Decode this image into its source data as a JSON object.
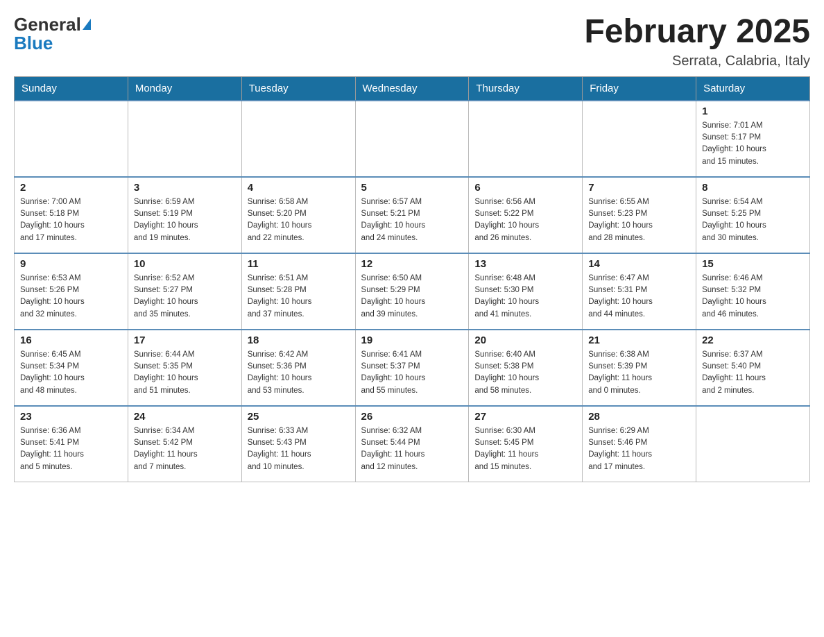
{
  "header": {
    "logo_general": "General",
    "logo_blue": "Blue",
    "month_title": "February 2025",
    "subtitle": "Serrata, Calabria, Italy"
  },
  "days_of_week": [
    "Sunday",
    "Monday",
    "Tuesday",
    "Wednesday",
    "Thursday",
    "Friday",
    "Saturday"
  ],
  "weeks": [
    {
      "days": [
        {
          "num": "",
          "info": ""
        },
        {
          "num": "",
          "info": ""
        },
        {
          "num": "",
          "info": ""
        },
        {
          "num": "",
          "info": ""
        },
        {
          "num": "",
          "info": ""
        },
        {
          "num": "",
          "info": ""
        },
        {
          "num": "1",
          "info": "Sunrise: 7:01 AM\nSunset: 5:17 PM\nDaylight: 10 hours\nand 15 minutes."
        }
      ]
    },
    {
      "days": [
        {
          "num": "2",
          "info": "Sunrise: 7:00 AM\nSunset: 5:18 PM\nDaylight: 10 hours\nand 17 minutes."
        },
        {
          "num": "3",
          "info": "Sunrise: 6:59 AM\nSunset: 5:19 PM\nDaylight: 10 hours\nand 19 minutes."
        },
        {
          "num": "4",
          "info": "Sunrise: 6:58 AM\nSunset: 5:20 PM\nDaylight: 10 hours\nand 22 minutes."
        },
        {
          "num": "5",
          "info": "Sunrise: 6:57 AM\nSunset: 5:21 PM\nDaylight: 10 hours\nand 24 minutes."
        },
        {
          "num": "6",
          "info": "Sunrise: 6:56 AM\nSunset: 5:22 PM\nDaylight: 10 hours\nand 26 minutes."
        },
        {
          "num": "7",
          "info": "Sunrise: 6:55 AM\nSunset: 5:23 PM\nDaylight: 10 hours\nand 28 minutes."
        },
        {
          "num": "8",
          "info": "Sunrise: 6:54 AM\nSunset: 5:25 PM\nDaylight: 10 hours\nand 30 minutes."
        }
      ]
    },
    {
      "days": [
        {
          "num": "9",
          "info": "Sunrise: 6:53 AM\nSunset: 5:26 PM\nDaylight: 10 hours\nand 32 minutes."
        },
        {
          "num": "10",
          "info": "Sunrise: 6:52 AM\nSunset: 5:27 PM\nDaylight: 10 hours\nand 35 minutes."
        },
        {
          "num": "11",
          "info": "Sunrise: 6:51 AM\nSunset: 5:28 PM\nDaylight: 10 hours\nand 37 minutes."
        },
        {
          "num": "12",
          "info": "Sunrise: 6:50 AM\nSunset: 5:29 PM\nDaylight: 10 hours\nand 39 minutes."
        },
        {
          "num": "13",
          "info": "Sunrise: 6:48 AM\nSunset: 5:30 PM\nDaylight: 10 hours\nand 41 minutes."
        },
        {
          "num": "14",
          "info": "Sunrise: 6:47 AM\nSunset: 5:31 PM\nDaylight: 10 hours\nand 44 minutes."
        },
        {
          "num": "15",
          "info": "Sunrise: 6:46 AM\nSunset: 5:32 PM\nDaylight: 10 hours\nand 46 minutes."
        }
      ]
    },
    {
      "days": [
        {
          "num": "16",
          "info": "Sunrise: 6:45 AM\nSunset: 5:34 PM\nDaylight: 10 hours\nand 48 minutes."
        },
        {
          "num": "17",
          "info": "Sunrise: 6:44 AM\nSunset: 5:35 PM\nDaylight: 10 hours\nand 51 minutes."
        },
        {
          "num": "18",
          "info": "Sunrise: 6:42 AM\nSunset: 5:36 PM\nDaylight: 10 hours\nand 53 minutes."
        },
        {
          "num": "19",
          "info": "Sunrise: 6:41 AM\nSunset: 5:37 PM\nDaylight: 10 hours\nand 55 minutes."
        },
        {
          "num": "20",
          "info": "Sunrise: 6:40 AM\nSunset: 5:38 PM\nDaylight: 10 hours\nand 58 minutes."
        },
        {
          "num": "21",
          "info": "Sunrise: 6:38 AM\nSunset: 5:39 PM\nDaylight: 11 hours\nand 0 minutes."
        },
        {
          "num": "22",
          "info": "Sunrise: 6:37 AM\nSunset: 5:40 PM\nDaylight: 11 hours\nand 2 minutes."
        }
      ]
    },
    {
      "days": [
        {
          "num": "23",
          "info": "Sunrise: 6:36 AM\nSunset: 5:41 PM\nDaylight: 11 hours\nand 5 minutes."
        },
        {
          "num": "24",
          "info": "Sunrise: 6:34 AM\nSunset: 5:42 PM\nDaylight: 11 hours\nand 7 minutes."
        },
        {
          "num": "25",
          "info": "Sunrise: 6:33 AM\nSunset: 5:43 PM\nDaylight: 11 hours\nand 10 minutes."
        },
        {
          "num": "26",
          "info": "Sunrise: 6:32 AM\nSunset: 5:44 PM\nDaylight: 11 hours\nand 12 minutes."
        },
        {
          "num": "27",
          "info": "Sunrise: 6:30 AM\nSunset: 5:45 PM\nDaylight: 11 hours\nand 15 minutes."
        },
        {
          "num": "28",
          "info": "Sunrise: 6:29 AM\nSunset: 5:46 PM\nDaylight: 11 hours\nand 17 minutes."
        },
        {
          "num": "",
          "info": ""
        }
      ]
    }
  ]
}
